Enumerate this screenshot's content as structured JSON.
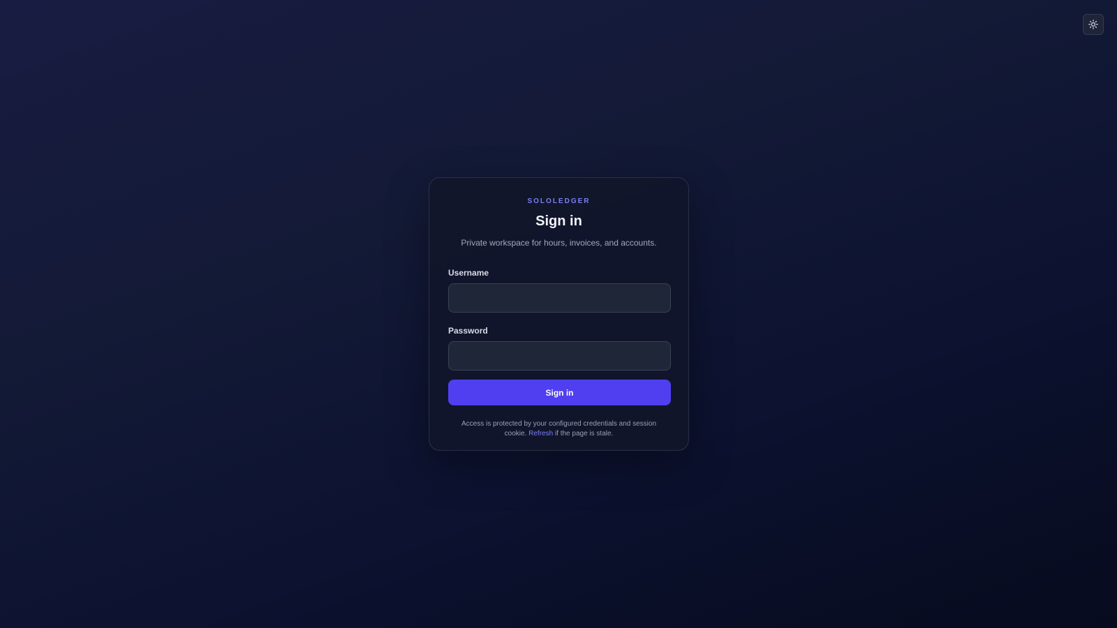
{
  "theme_toggle": {
    "icon": "sun-icon"
  },
  "card": {
    "brand": "SOLOLEDGER",
    "title": "Sign in",
    "subtitle": "Private workspace for hours, invoices, and accounts.",
    "username_label": "Username",
    "username_value": "",
    "password_label": "Password",
    "password_value": "",
    "submit_label": "Sign in",
    "footnote_before": "Access is protected by your configured credentials and session cookie.",
    "footnote_link": "Refresh",
    "footnote_after": "if the page is stale."
  },
  "colors": {
    "accent": "#4f3ff0",
    "brand_text": "#7b7ff2",
    "card_background": "#11162a",
    "page_background": "#131a36"
  }
}
